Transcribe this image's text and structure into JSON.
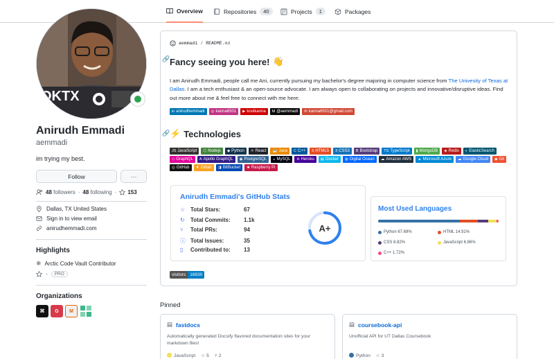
{
  "tabs": [
    {
      "label": "Overview",
      "active": true,
      "icon": "book-icon"
    },
    {
      "label": "Repositories",
      "count": "40",
      "icon": "repo-icon"
    },
    {
      "label": "Projects",
      "count": "1",
      "icon": "project-icon"
    },
    {
      "label": "Packages",
      "icon": "package-icon"
    }
  ],
  "profile": {
    "fullname": "Anirudh Emmadi",
    "login": "aemmadi",
    "bio": "im trying my best.",
    "follow_label": "Follow",
    "more_label": "···",
    "followers": "48",
    "followers_label": "followers",
    "following": "48",
    "following_label": "following",
    "stars": "153",
    "location": "Dallas, TX United States",
    "email": "Sign in to view email",
    "website": "anirudhemmadi.com",
    "status_color": "#2da44e"
  },
  "highlights": {
    "heading": "Highlights",
    "items": [
      "Arctic Code Vault Contributor",
      "PRO"
    ]
  },
  "organizations": {
    "heading": "Organizations",
    "items": [
      {
        "name": "org-1",
        "color": "#111111",
        "glyph": "⌘"
      },
      {
        "name": "org-2",
        "color": "#d73a49",
        "glyph": "G"
      },
      {
        "name": "org-3",
        "color": "#e36209",
        "glyph": "M"
      },
      {
        "name": "org-4",
        "color": "#3fb68b",
        "glyph": "▞"
      }
    ]
  },
  "readme": {
    "path_user": "aemmadi",
    "path_sep": "/",
    "path_file": "README",
    "path_ext": ".md",
    "heading": "Fancy seeing you here!",
    "wave": "👋",
    "intro_1": "I am Anirudh Emmadi, people call me Ani, currently pursuing my bachelor's degree majoring in computer science from ",
    "intro_link": "The Univesity of Texas at Dallas",
    "intro_2": ". I am a tech enthusiast & an open-source advocate. I am always open to collaborating on projects and innovative/disruptive ideas. Find out more about me & feel free to connect with me here:",
    "social": [
      {
        "label": "anirudhemmadi",
        "color": "#0077b5",
        "icon": "in"
      },
      {
        "label": "kanna6501",
        "color": "#c13584",
        "icon": "◎"
      },
      {
        "label": "koolkanna",
        "color": "#cc0000",
        "icon": "▶"
      },
      {
        "label": "@aemmadi",
        "color": "#0a0a0a",
        "icon": "M"
      },
      {
        "label": "kanna6501@gmail.com",
        "color": "#d14836",
        "icon": "✉"
      }
    ],
    "tech_heading": "Technologies",
    "tech_emoji": "⚡",
    "tech": [
      {
        "label": "JavaScript",
        "color": "#323330",
        "icon": "JS"
      },
      {
        "label": "Nodejs",
        "color": "#43853d",
        "icon": "⬡"
      },
      {
        "label": "Python",
        "color": "#14354c",
        "icon": "◆"
      },
      {
        "label": "React",
        "color": "#20232a",
        "icon": "⚛"
      },
      {
        "label": "Java",
        "color": "#ed8b00",
        "icon": "☕"
      },
      {
        "label": "C++",
        "color": "#00599c",
        "icon": "C"
      },
      {
        "label": "HTML5",
        "color": "#e34f26",
        "icon": "5"
      },
      {
        "label": "CSS3",
        "color": "#1572b6",
        "icon": "3"
      },
      {
        "label": "Bootstrap",
        "color": "#563d7c",
        "icon": "B"
      },
      {
        "label": "TypeScript",
        "color": "#007acc",
        "icon": "TS"
      },
      {
        "label": "MongoDB",
        "color": "#4ea94b",
        "icon": "▮"
      },
      {
        "label": "Redis",
        "color": "#b71c1c",
        "icon": "◈"
      },
      {
        "label": "ElasticSearch",
        "color": "#005571",
        "icon": "◐"
      },
      {
        "label": "GraphQL",
        "color": "#e10098",
        "icon": "◇"
      },
      {
        "label": "Apollo GraphQL",
        "color": "#311c87",
        "icon": "A"
      },
      {
        "label": "PostgreSQL",
        "color": "#316192",
        "icon": "◉"
      },
      {
        "label": "MySQL",
        "color": "#00000f",
        "icon": "◒"
      },
      {
        "label": "Heroku",
        "color": "#430098",
        "icon": "H"
      },
      {
        "label": "Docker",
        "color": "#0db7ed",
        "icon": "▤"
      },
      {
        "label": "Digital Ocean",
        "color": "#0167ff",
        "icon": "◍"
      },
      {
        "label": "Amazon AWS",
        "color": "#232f3e",
        "icon": "☁"
      },
      {
        "label": "Microsoft Azure",
        "color": "#0089d6",
        "icon": "▲"
      },
      {
        "label": "Google Cloud",
        "color": "#4285f4",
        "icon": "☁"
      },
      {
        "label": "Git",
        "color": "#f05033",
        "icon": "◆"
      },
      {
        "label": "GitHub",
        "color": "#121011",
        "icon": "◎"
      },
      {
        "label": "Gitlab",
        "color": "#fca121",
        "icon": "▼"
      },
      {
        "label": "BitBucket",
        "color": "#0047b3",
        "icon": "◨"
      },
      {
        "label": "Raspberry Pi",
        "color": "#c51a4a",
        "icon": "❀"
      }
    ],
    "stats": {
      "title": "Anirudh Emmadi's GitHub Stats",
      "rows": [
        {
          "label": "Total Stars:",
          "value": "67",
          "icon": "star-icon"
        },
        {
          "label": "Total Commits:",
          "value": "1.1k",
          "icon": "history-icon"
        },
        {
          "label": "Total PRs:",
          "value": "94",
          "icon": "pr-icon"
        },
        {
          "label": "Total Issues:",
          "value": "35",
          "icon": "issue-icon"
        },
        {
          "label": "Contributed to:",
          "value": "13",
          "icon": "repo-icon"
        }
      ],
      "grade": "A+",
      "ring_progress": 0.72
    },
    "languages": {
      "title": "Most Used Languages",
      "items": [
        {
          "label": "Python 67.69%",
          "percent": 67.69,
          "color": "#3572A5"
        },
        {
          "label": "HTML 14.91%",
          "percent": 14.91,
          "color": "#e34c26"
        },
        {
          "label": "CSS 8.82%",
          "percent": 8.82,
          "color": "#563d7c"
        },
        {
          "label": "JavaScript 6.86%",
          "percent": 6.86,
          "color": "#f1e05a"
        },
        {
          "label": "C++ 1.72%",
          "percent": 1.72,
          "color": "#f34b7d"
        }
      ]
    },
    "visitors_label": "visitors",
    "visitors_count": "16830"
  },
  "pinned": {
    "heading": "Pinned",
    "repos": [
      {
        "name": "fastdocs",
        "desc": "Automatically generated Docsify flavored documentation sites for your markdown files!",
        "lang": "JavaScript",
        "lang_color": "#f1e05a",
        "stars": "5",
        "forks": "2"
      },
      {
        "name": "coursebook-api",
        "desc": "Unofficial API for UT Dallas Coursebook",
        "lang": "Python",
        "lang_color": "#3572A5",
        "stars": "3"
      }
    ]
  }
}
